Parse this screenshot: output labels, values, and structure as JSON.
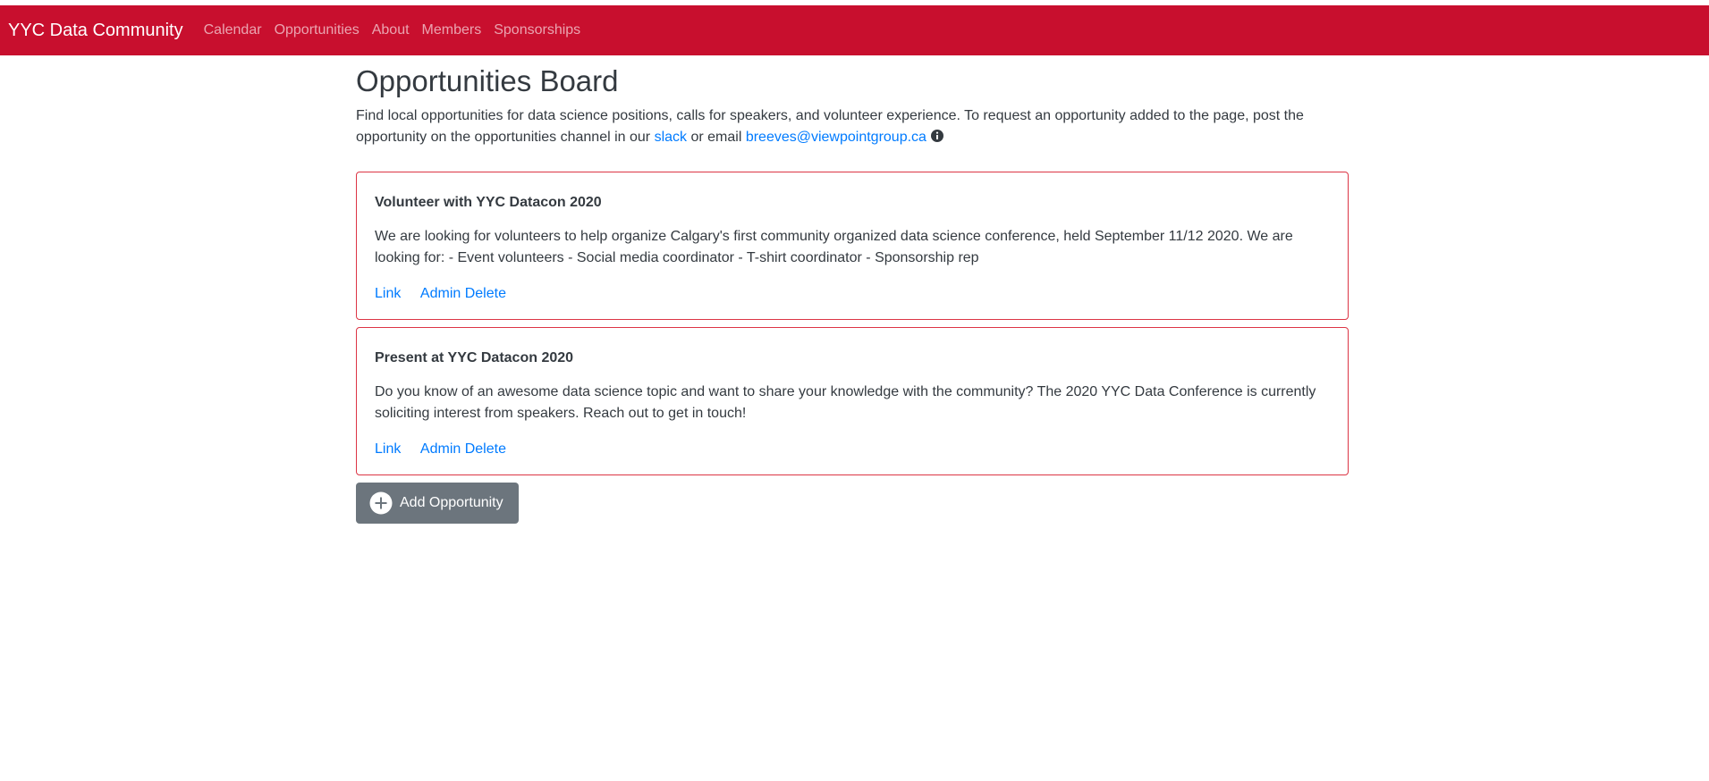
{
  "navbar": {
    "brand": "YYC Data Community",
    "links": [
      "Calendar",
      "Opportunities",
      "About",
      "Members",
      "Sponsorships"
    ],
    "background": "#c80f2e"
  },
  "page": {
    "title": "Opportunities Board",
    "intro_part1": "Find local opportunities for data science positions, calls for speakers, and volunteer experience. To request an opportunity added to the page, post the opportunity on the opportunities channel in our ",
    "slack_link": "slack",
    "intro_part2": " or email ",
    "email_link": "breeves@viewpointgroup.ca",
    "info_icon": "info-circle-icon"
  },
  "opportunities": [
    {
      "title": "Volunteer with YYC Datacon 2020",
      "description": "We are looking for volunteers to help organize Calgary's first community organized data science conference, held September 11/12 2020. We are looking for: - Event volunteers - Social media coordinator - T-shirt coordinator - Sponsorship rep",
      "link_label": "Link",
      "delete_label": "Admin Delete"
    },
    {
      "title": "Present at YYC Datacon 2020",
      "description": "Do you know of an awesome data science topic and want to share your knowledge with the community? The 2020 YYC Data Conference is currently soliciting interest from speakers. Reach out to get in touch!",
      "link_label": "Link",
      "delete_label": "Admin Delete"
    }
  ],
  "add_button": {
    "label": "Add Opportunity",
    "icon": "plus-circle-icon"
  },
  "colors": {
    "accent": "#c80f2e",
    "card_border": "#dc3545",
    "link": "#007bff",
    "button": "#6c757d"
  }
}
